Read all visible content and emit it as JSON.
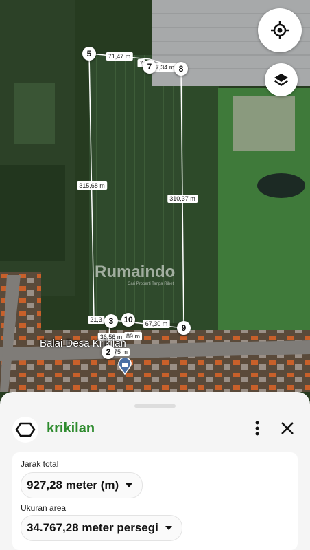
{
  "map": {
    "watermark": {
      "brand": "Rumaindo",
      "tagline": "Cari Properti Tanpa Ribet"
    },
    "place_label": "Balai Desa Krikilan",
    "points": [
      {
        "id": "2",
        "label": "2"
      },
      {
        "id": "3",
        "label": "3"
      },
      {
        "id": "5",
        "label": "5"
      },
      {
        "id": "7",
        "label": "7"
      },
      {
        "id": "8",
        "label": "8"
      },
      {
        "id": "9",
        "label": "9"
      },
      {
        "id": "10",
        "label": "10"
      }
    ],
    "measurements": {
      "top_left": "71,47 m",
      "top_small": "7",
      "top_right": "37,34 m",
      "left_side": "315,68 m",
      "right_side": "310,37 m",
      "bottom_a": "21,3",
      "bottom_b": "36,56 m",
      "bottom_c": "89 m",
      "bottom_d": "67,30 m",
      "bottom_e": "75 m"
    },
    "buttons": {
      "locate_icon": "my-location-icon",
      "layers_icon": "layers-icon"
    },
    "colors": {
      "accent": "#2e8b2e"
    }
  },
  "sheet": {
    "title": "krikilan",
    "total_distance_label": "Jarak total",
    "total_distance_value": "927,28 meter (m)",
    "area_label": "Ukuran area",
    "area_value": "34.767,28 meter persegi"
  }
}
